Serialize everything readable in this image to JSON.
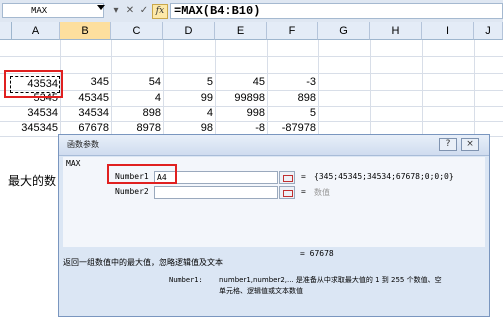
{
  "formula_bar": {
    "name_box": "MAX",
    "formula": "=MAX(B4:B10)",
    "fx_label": "fx"
  },
  "columns": [
    "A",
    "B",
    "C",
    "D",
    "E",
    "F",
    "G",
    "H",
    "I",
    "J"
  ],
  "rows": [
    [
      "43534",
      "345",
      "54",
      "5",
      "45",
      "-3"
    ],
    [
      "5345",
      "45345",
      "4",
      "99",
      "99898",
      "898"
    ],
    [
      "34534",
      "34534",
      "898",
      "4",
      "998",
      "5"
    ],
    [
      "345345",
      "67678",
      "8978",
      "98",
      "-8",
      "-87978"
    ]
  ],
  "side_label": "最大的数",
  "dialog": {
    "title": "函数参数",
    "help_button": "?",
    "close_button": "×",
    "function_name": "MAX",
    "arg1_label": "Number1",
    "arg1_value": "A4",
    "arg1_result": "{345;45345;34534;67678;0;0;0}",
    "arg2_label": "Number2",
    "arg2_value": "",
    "arg2_result": "数值",
    "equals": "=",
    "result": "= 67678",
    "description": "返回一组数值中的最大值，忽略逻辑值及文本",
    "arg_desc_name": "Number1:",
    "arg_desc_line1": "number1,number2,...  是准备从中求取最大值的 1 到 255 个数值、空",
    "arg_desc_line2": "单元格、逻辑值或文本数值"
  }
}
